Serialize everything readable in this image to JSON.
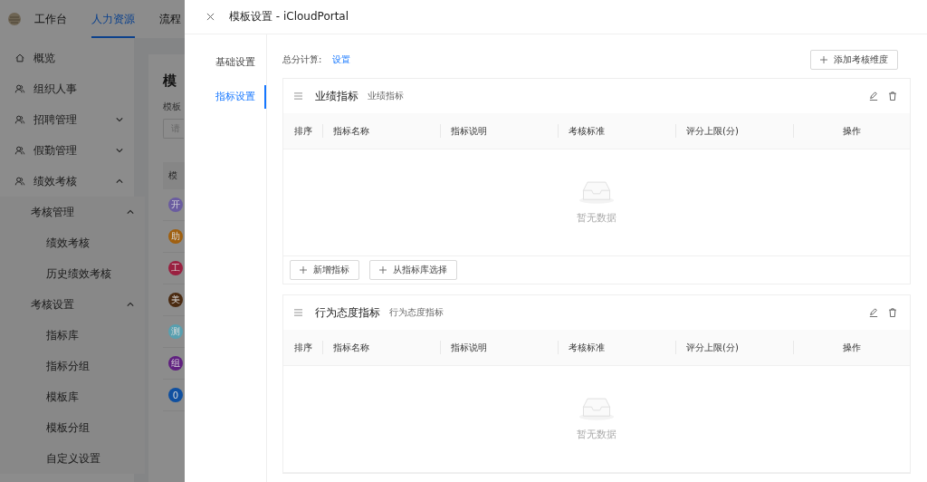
{
  "app": {
    "header_tabs": [
      {
        "label": "工作台",
        "selected": false
      },
      {
        "label": "人力资源",
        "selected": true
      },
      {
        "label": "流程",
        "selected": false
      }
    ],
    "sidebar": {
      "items": [
        {
          "label": "概览",
          "kind": "home"
        },
        {
          "label": "组织人事",
          "kind": "people"
        },
        {
          "label": "招聘管理",
          "kind": "people",
          "expanded": false
        },
        {
          "label": "假勤管理",
          "kind": "people",
          "expanded": false
        },
        {
          "label": "绩效考核",
          "kind": "people",
          "expanded": true,
          "children": [
            {
              "label": "考核管理",
              "expanded": true,
              "children": [
                {
                  "label": "绩效考核"
                },
                {
                  "label": "历史绩效考核"
                }
              ]
            },
            {
              "label": "考核设置",
              "expanded": true,
              "children": [
                {
                  "label": "指标库"
                },
                {
                  "label": "指标分组"
                },
                {
                  "label": "模板库"
                },
                {
                  "label": "模板分组"
                },
                {
                  "label": "自定义设置"
                }
              ]
            }
          ]
        }
      ]
    },
    "page": {
      "title": "模",
      "filter_label": "模板",
      "filter_placeholder": "请",
      "table_header": "模",
      "avatars": [
        {
          "char": "开",
          "color": "#6a5ca0"
        },
        {
          "char": "助",
          "color": "#a06010"
        },
        {
          "char": "工",
          "color": "#9a2040"
        },
        {
          "char": "美",
          "color": "#4a2a10"
        },
        {
          "char": "测",
          "color": "#58a0b0"
        },
        {
          "char": "组",
          "color": "#602080"
        },
        {
          "char": "0",
          "color": "#1050a0"
        }
      ]
    }
  },
  "drawer": {
    "title": "模板设置 - iCloudPortal",
    "nav": [
      {
        "label": "基础设置",
        "selected": false
      },
      {
        "label": "指标设置",
        "selected": true
      }
    ],
    "total_label": "总分计算:",
    "total_link": "设置",
    "add_button": "添加考核维度",
    "sections": [
      {
        "title": "业绩指标",
        "subtitle": "业绩指标",
        "columns": [
          "排序",
          "指标名称",
          "指标说明",
          "考核标准",
          "评分上限(分)",
          "操作"
        ],
        "empty_text": "暂无数据",
        "footer_buttons": [
          "新增指标",
          "从指标库选择"
        ]
      },
      {
        "title": "行为态度指标",
        "subtitle": "行为态度指标",
        "columns": [
          "排序",
          "指标名称",
          "指标说明",
          "考核标准",
          "评分上限(分)",
          "操作"
        ],
        "empty_text": "暂无数据"
      }
    ]
  }
}
